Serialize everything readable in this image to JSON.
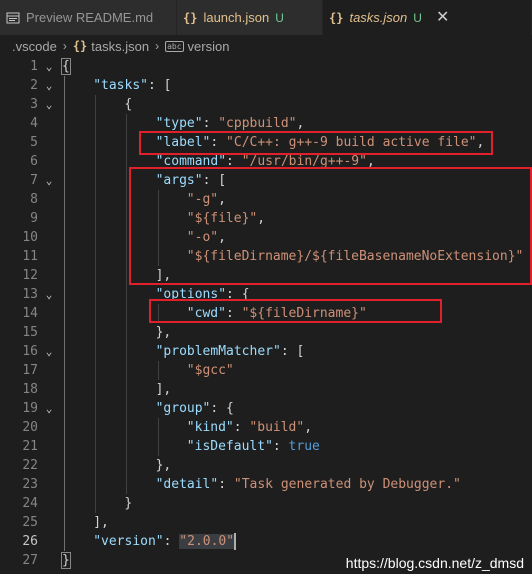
{
  "tabs": [
    {
      "label": "Preview README.md",
      "git": "",
      "closable": false
    },
    {
      "label": "launch.json",
      "git": "U",
      "closable": false
    },
    {
      "label": "tasks.json",
      "git": "U",
      "closable": true
    }
  ],
  "breadcrumb": {
    "folder": ".vscode",
    "file": "tasks.json",
    "symbol": "version"
  },
  "editor": {
    "current_line": 26,
    "lines": [
      {
        "n": 1,
        "fold": "v",
        "indent": 0,
        "tokens": [
          {
            "t": "{",
            "c": "p",
            "match": true
          }
        ]
      },
      {
        "n": 2,
        "fold": "v",
        "indent": 1,
        "tokens": [
          {
            "t": "\"tasks\"",
            "c": "k"
          },
          {
            "t": ": [",
            "c": "p"
          }
        ]
      },
      {
        "n": 3,
        "fold": "v",
        "indent": 2,
        "tokens": [
          {
            "t": "{",
            "c": "p"
          }
        ]
      },
      {
        "n": 4,
        "fold": "",
        "indent": 3,
        "tokens": [
          {
            "t": "\"type\"",
            "c": "k"
          },
          {
            "t": ": ",
            "c": "p"
          },
          {
            "t": "\"cppbuild\"",
            "c": "s"
          },
          {
            "t": ",",
            "c": "p"
          }
        ]
      },
      {
        "n": 5,
        "fold": "",
        "indent": 3,
        "tokens": [
          {
            "t": "\"label\"",
            "c": "k"
          },
          {
            "t": ": ",
            "c": "p"
          },
          {
            "t": "\"C/C++: g++-9 build active file\"",
            "c": "s"
          },
          {
            "t": ",",
            "c": "p"
          }
        ]
      },
      {
        "n": 6,
        "fold": "",
        "indent": 3,
        "tokens": [
          {
            "t": "\"command\"",
            "c": "k"
          },
          {
            "t": ": ",
            "c": "p"
          },
          {
            "t": "\"/usr/bin/g++-9\"",
            "c": "s"
          },
          {
            "t": ",",
            "c": "p"
          }
        ]
      },
      {
        "n": 7,
        "fold": "v",
        "indent": 3,
        "tokens": [
          {
            "t": "\"args\"",
            "c": "k"
          },
          {
            "t": ": [",
            "c": "p"
          }
        ]
      },
      {
        "n": 8,
        "fold": "",
        "indent": 4,
        "tokens": [
          {
            "t": "\"-g\"",
            "c": "s"
          },
          {
            "t": ",",
            "c": "p"
          }
        ]
      },
      {
        "n": 9,
        "fold": "",
        "indent": 4,
        "tokens": [
          {
            "t": "\"${file}\"",
            "c": "s"
          },
          {
            "t": ",",
            "c": "p"
          }
        ]
      },
      {
        "n": 10,
        "fold": "",
        "indent": 4,
        "tokens": [
          {
            "t": "\"-o\"",
            "c": "s"
          },
          {
            "t": ",",
            "c": "p"
          }
        ]
      },
      {
        "n": 11,
        "fold": "",
        "indent": 4,
        "tokens": [
          {
            "t": "\"${fileDirname}/${fileBasenameNoExtension}\"",
            "c": "s"
          }
        ]
      },
      {
        "n": 12,
        "fold": "",
        "indent": 3,
        "tokens": [
          {
            "t": "],",
            "c": "p"
          }
        ]
      },
      {
        "n": 13,
        "fold": "v",
        "indent": 3,
        "tokens": [
          {
            "t": "\"options\"",
            "c": "k"
          },
          {
            "t": ": {",
            "c": "p"
          }
        ]
      },
      {
        "n": 14,
        "fold": "",
        "indent": 4,
        "tokens": [
          {
            "t": "\"cwd\"",
            "c": "k"
          },
          {
            "t": ": ",
            "c": "p"
          },
          {
            "t": "\"${fileDirname}\"",
            "c": "s"
          }
        ]
      },
      {
        "n": 15,
        "fold": "",
        "indent": 3,
        "tokens": [
          {
            "t": "},",
            "c": "p"
          }
        ]
      },
      {
        "n": 16,
        "fold": "v",
        "indent": 3,
        "tokens": [
          {
            "t": "\"problemMatcher\"",
            "c": "k"
          },
          {
            "t": ": [",
            "c": "p"
          }
        ]
      },
      {
        "n": 17,
        "fold": "",
        "indent": 4,
        "tokens": [
          {
            "t": "\"$gcc\"",
            "c": "s"
          }
        ]
      },
      {
        "n": 18,
        "fold": "",
        "indent": 3,
        "tokens": [
          {
            "t": "],",
            "c": "p"
          }
        ]
      },
      {
        "n": 19,
        "fold": "v",
        "indent": 3,
        "tokens": [
          {
            "t": "\"group\"",
            "c": "k"
          },
          {
            "t": ": {",
            "c": "p"
          }
        ]
      },
      {
        "n": 20,
        "fold": "",
        "indent": 4,
        "tokens": [
          {
            "t": "\"kind\"",
            "c": "k"
          },
          {
            "t": ": ",
            "c": "p"
          },
          {
            "t": "\"build\"",
            "c": "s"
          },
          {
            "t": ",",
            "c": "p"
          }
        ]
      },
      {
        "n": 21,
        "fold": "",
        "indent": 4,
        "tokens": [
          {
            "t": "\"isDefault\"",
            "c": "k"
          },
          {
            "t": ": ",
            "c": "p"
          },
          {
            "t": "true",
            "c": "b"
          }
        ]
      },
      {
        "n": 22,
        "fold": "",
        "indent": 3,
        "tokens": [
          {
            "t": "},",
            "c": "p"
          }
        ]
      },
      {
        "n": 23,
        "fold": "",
        "indent": 3,
        "tokens": [
          {
            "t": "\"detail\"",
            "c": "k"
          },
          {
            "t": ": ",
            "c": "p"
          },
          {
            "t": "\"Task generated by Debugger.\"",
            "c": "s"
          }
        ]
      },
      {
        "n": 24,
        "fold": "",
        "indent": 2,
        "tokens": [
          {
            "t": "}",
            "c": "p"
          }
        ]
      },
      {
        "n": 25,
        "fold": "",
        "indent": 1,
        "tokens": [
          {
            "t": "],",
            "c": "p"
          }
        ]
      },
      {
        "n": 26,
        "fold": "",
        "indent": 1,
        "tokens": [
          {
            "t": "\"version\"",
            "c": "k"
          },
          {
            "t": ": ",
            "c": "p"
          },
          {
            "t": "\"2.0.0\"",
            "c": "s",
            "selected": true
          }
        ]
      },
      {
        "n": 27,
        "fold": "",
        "indent": 0,
        "tokens": [
          {
            "t": "}",
            "c": "p",
            "match": true
          }
        ]
      }
    ]
  },
  "watermark": "https://blog.csdn.net/z_dmsd",
  "colors": {
    "editor_bg": "#1e1e1e",
    "tab_bg": "#2d2d2d",
    "key": "#9cdcfe",
    "string": "#ce9178",
    "boolean": "#569cd6",
    "annotation_box": "#e0202a"
  }
}
